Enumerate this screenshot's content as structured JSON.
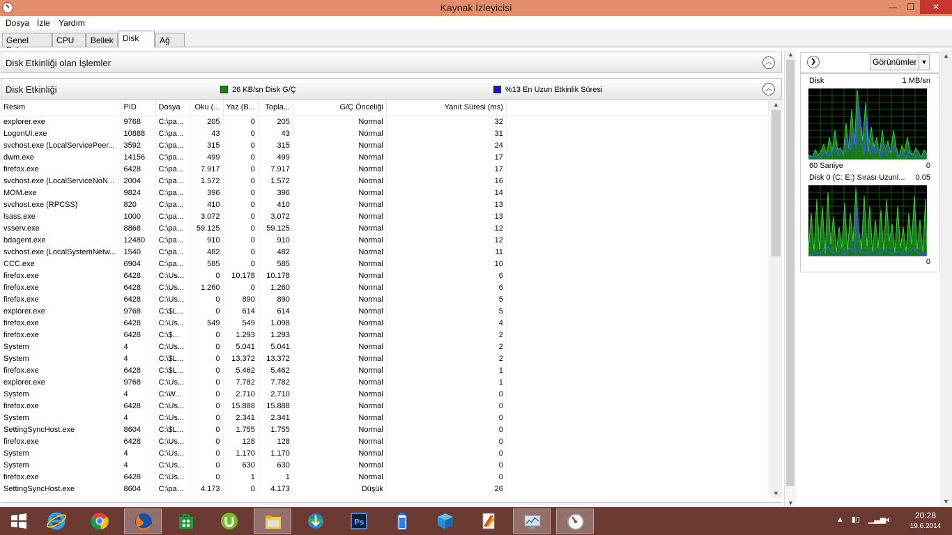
{
  "window": {
    "title": "Kaynak İzleyicisi",
    "min": "—",
    "max": "❐",
    "close": "✕"
  },
  "menu": [
    "Dosya",
    "İzle",
    "Yardım"
  ],
  "tabs": [
    "Genel Bakış",
    "CPU",
    "Bellek",
    "Disk",
    "Ağ"
  ],
  "active_tab": "Disk",
  "sections": {
    "processes": "Disk Etkinliği olan İşlemler",
    "activity": "Disk Etkinliği"
  },
  "legend": {
    "io": {
      "text": "26 KB/sn Disk G/Ç",
      "color": "#0c8a0c"
    },
    "active_time": {
      "text": "%13 En Uzun Etkinlik Süresi",
      "color": "#1515d0"
    }
  },
  "table": {
    "headers": [
      "Resim",
      "PID",
      "Dosya",
      "Oku (...",
      "Yaz (B...",
      "Topla...",
      "G/Ç Önceliği",
      "Yanıt Süresi (ms)"
    ],
    "rows": [
      [
        "explorer.exe",
        "9768",
        "C:\\pa...",
        "205",
        "0",
        "205",
        "Normal",
        "32"
      ],
      [
        "LogonUI.exe",
        "10888",
        "C:\\pa...",
        "43",
        "0",
        "43",
        "Normal",
        "31"
      ],
      [
        "svchost.exe (LocalServicePeer...",
        "3592",
        "C:\\pa...",
        "315",
        "0",
        "315",
        "Normal",
        "24"
      ],
      [
        "dwm.exe",
        "14156",
        "C:\\pa...",
        "499",
        "0",
        "499",
        "Normal",
        "17"
      ],
      [
        "firefox.exe",
        "6428",
        "C:\\pa...",
        "7.917",
        "0",
        "7.917",
        "Normal",
        "17"
      ],
      [
        "svchost.exe (LocalServiceNoN...",
        "2004",
        "C:\\pa...",
        "1.572",
        "0",
        "1.572",
        "Normal",
        "16"
      ],
      [
        "MOM.exe",
        "9824",
        "C:\\pa...",
        "396",
        "0",
        "396",
        "Normal",
        "14"
      ],
      [
        "svchost.exe (RPCSS)",
        "820",
        "C:\\pa...",
        "410",
        "0",
        "410",
        "Normal",
        "13"
      ],
      [
        "lsass.exe",
        "1000",
        "C:\\pa...",
        "3.072",
        "0",
        "3.072",
        "Normal",
        "13"
      ],
      [
        "vsserv.exe",
        "8868",
        "C:\\pa...",
        "59.125",
        "0",
        "59.125",
        "Normal",
        "12"
      ],
      [
        "bdagent.exe",
        "12480",
        "C:\\pa...",
        "910",
        "0",
        "910",
        "Normal",
        "12"
      ],
      [
        "svchost.exe (LocalSystemNetw...",
        "1540",
        "C:\\pa...",
        "482",
        "0",
        "482",
        "Normal",
        "11"
      ],
      [
        "CCC.exe",
        "6904",
        "C:\\pa...",
        "585",
        "0",
        "585",
        "Normal",
        "10"
      ],
      [
        "firefox.exe",
        "6428",
        "C:\\Us...",
        "0",
        "10.178",
        "10.178",
        "Normal",
        "6"
      ],
      [
        "firefox.exe",
        "6428",
        "C:\\Us...",
        "1.260",
        "0",
        "1.260",
        "Normal",
        "6"
      ],
      [
        "firefox.exe",
        "6428",
        "C:\\Us...",
        "0",
        "890",
        "890",
        "Normal",
        "5"
      ],
      [
        "explorer.exe",
        "9768",
        "C:\\$L...",
        "0",
        "614",
        "614",
        "Normal",
        "5"
      ],
      [
        "firefox.exe",
        "6428",
        "C:\\Us...",
        "549",
        "549",
        "1.098",
        "Normal",
        "4"
      ],
      [
        "firefox.exe",
        "6428",
        "C:\\$...",
        "0",
        "1.293",
        "1.293",
        "Normal",
        "2"
      ],
      [
        "System",
        "4",
        "C:\\Us...",
        "0",
        "5.041",
        "5.041",
        "Normal",
        "2"
      ],
      [
        "System",
        "4",
        "C:\\$L...",
        "0",
        "13.372",
        "13.372",
        "Normal",
        "2"
      ],
      [
        "firefox.exe",
        "6428",
        "C:\\$L...",
        "0",
        "5.462",
        "5.462",
        "Normal",
        "1"
      ],
      [
        "explorer.exe",
        "9768",
        "C:\\Us...",
        "0",
        "7.782",
        "7.782",
        "Normal",
        "1"
      ],
      [
        "System",
        "4",
        "C:\\W...",
        "0",
        "2.710",
        "2.710",
        "Normal",
        "0"
      ],
      [
        "firefox.exe",
        "6428",
        "C:\\Us...",
        "0",
        "15.888",
        "15.888",
        "Normal",
        "0"
      ],
      [
        "System",
        "4",
        "C:\\Us...",
        "0",
        "2.341",
        "2.341",
        "Normal",
        "0"
      ],
      [
        "SettingSyncHost.exe",
        "8604",
        "C:\\$L...",
        "0",
        "1.755",
        "1.755",
        "Normal",
        "0"
      ],
      [
        "firefox.exe",
        "6428",
        "C:\\Us...",
        "0",
        "128",
        "128",
        "Normal",
        "0"
      ],
      [
        "System",
        "4",
        "C:\\Us...",
        "0",
        "1.170",
        "1.170",
        "Normal",
        "0"
      ],
      [
        "System",
        "4",
        "C:\\Us...",
        "0",
        "630",
        "630",
        "Normal",
        "0"
      ],
      [
        "firefox.exe",
        "6428",
        "C:\\Us...",
        "0",
        "1",
        "1",
        "Normal",
        "0"
      ],
      [
        "SettingSyncHost.exe",
        "8604",
        "C:\\pa...",
        "4.173",
        "0",
        "4.173",
        "Düşük",
        "26"
      ]
    ]
  },
  "side_panel": {
    "views_button": "Görünümler",
    "disk_graph": {
      "title": "Disk",
      "max": "1 MB/sn",
      "time": "60 Saniye",
      "min": "0"
    },
    "queue_graph": {
      "title": "Disk 0 (C: E:) Sırası Uzunl...",
      "max": "0.05",
      "min": "0"
    }
  },
  "taskbar": {
    "icons": [
      "windows-start-icon",
      "internet-explorer-icon",
      "chrome-icon",
      "firefox-icon",
      "store-icon",
      "utorrent-icon",
      "file-explorer-icon",
      "download-manager-icon",
      "photoshop-icon",
      "battery-app-icon",
      "box-app-icon",
      "office-app-icon",
      "monitor-app-icon",
      "resource-monitor-icon"
    ],
    "time": "20:28",
    "date": "19.6.2014"
  }
}
